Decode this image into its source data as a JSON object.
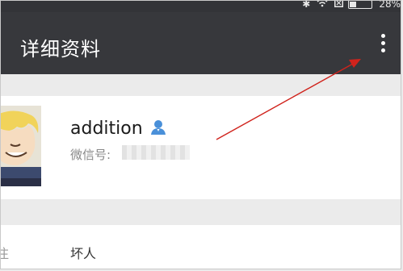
{
  "status_bar": {
    "battery_level": 0.28,
    "battery_text": "28%",
    "icons": [
      "bluetooth-icon",
      "wifi-icon",
      "sim-icon",
      "battery-icon"
    ]
  },
  "header": {
    "title": "详细资料",
    "more_icon": "more-vertical-icon"
  },
  "profile": {
    "nickname": "addition",
    "contact_icon": "person-icon",
    "wechat_id_label": "微信号:",
    "wechat_id_value": "",
    "avatar_icon": "avatar-image"
  },
  "remark_row": {
    "label": "注",
    "value": "坏人"
  },
  "annotation": {
    "color": "#d0231c"
  },
  "colors": {
    "header_bg": "#37383c",
    "accent_blue": "#4a90d9"
  }
}
